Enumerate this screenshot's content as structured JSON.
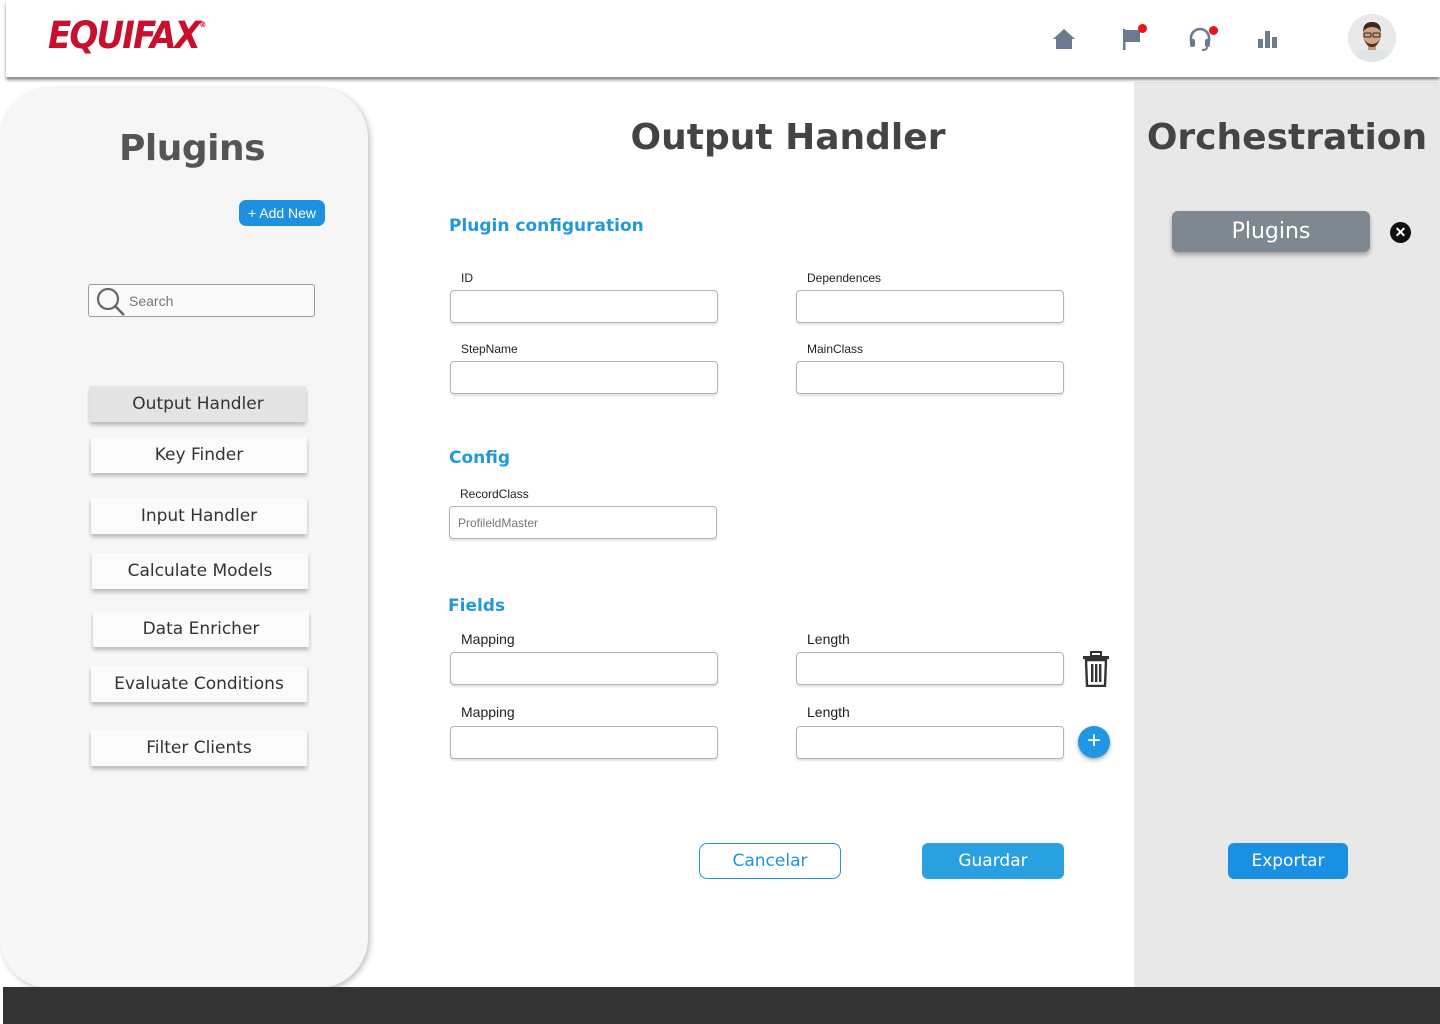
{
  "header": {
    "logo_text": "EQUIFAX",
    "logo_mark": "®",
    "icons": [
      "home-icon",
      "flag-icon",
      "headset-icon",
      "bar-chart-icon"
    ],
    "notification_color": "#e8141c"
  },
  "sidebar": {
    "title": "Plugins",
    "add_new_label": "+ Add New",
    "search_placeholder": "Search",
    "items": [
      {
        "label": "Output Handler",
        "active": true
      },
      {
        "label": "Key Finder"
      },
      {
        "label": "Input Handler"
      },
      {
        "label": "Calculate Models"
      },
      {
        "label": "Data Enricher"
      },
      {
        "label": "Evaluate Conditions"
      },
      {
        "label": "Filter Clients"
      }
    ]
  },
  "main": {
    "title": "Output Handler",
    "plugin_config": {
      "heading": "Plugin  configuration",
      "id_label": "ID",
      "dependences_label": "Dependences",
      "stepname_label": "StepName",
      "mainclass_label": "MainClass"
    },
    "config": {
      "heading": "Config",
      "recordclass_label": "RecordClass",
      "recordclass_placeholder": "ProfileldMaster"
    },
    "fields": {
      "heading": "Fields",
      "rows": [
        {
          "mapping_label": "Mapping",
          "length_label": "Length"
        },
        {
          "mapping_label": "Mapping",
          "length_label": "Length"
        }
      ]
    },
    "cancel_label": "Cancelar",
    "save_label": "Guardar",
    "add_icon": "+",
    "accent_color": "#2198dc"
  },
  "orchestration": {
    "title": "Orchestration",
    "chip_label": "Plugins",
    "close_icon": "✕",
    "export_label": "Exportar"
  }
}
